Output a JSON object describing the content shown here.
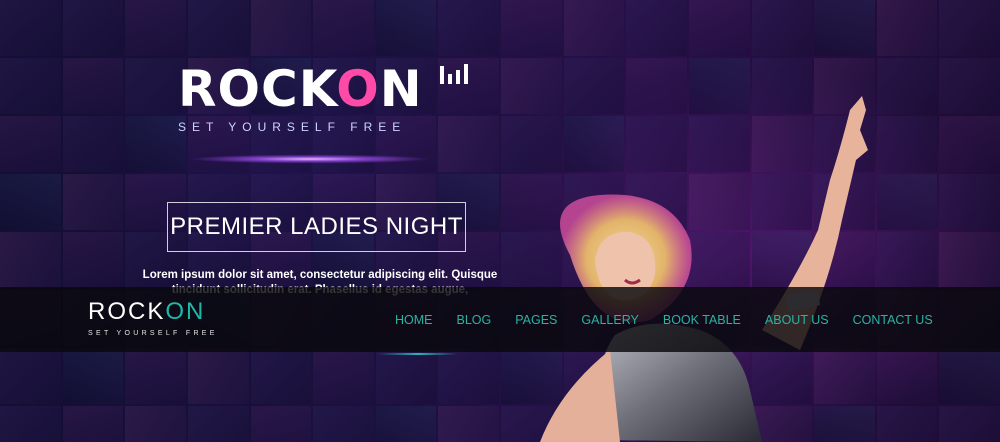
{
  "hero": {
    "logo_word_a": "ROCK",
    "logo_word_o": "O",
    "logo_word_n": "N",
    "logo_tagline": "SET YOURSELF FREE",
    "banner_title": "PREMIER LADIES NIGHT",
    "description": "Lorem ipsum dolor sit amet, consectetur adipiscing elit. Quisque tincidunt sollicitudin erat. Phasellus id egestas augue,"
  },
  "navbar": {
    "logo_word": "ROCK",
    "logo_accent": "ON",
    "logo_tagline": "SET YOURSELF FREE",
    "menu": [
      {
        "label": "HOME"
      },
      {
        "label": "BLOG"
      },
      {
        "label": "PAGES"
      },
      {
        "label": "GALLERY"
      },
      {
        "label": "BOOK TABLE"
      },
      {
        "label": "ABOUT US"
      },
      {
        "label": "CONTACT US"
      }
    ]
  },
  "colors": {
    "accent_teal": "#2ab3a3",
    "accent_pink": "#ff4aa8",
    "navbar_bg": "#08080c"
  },
  "icons": {
    "logo_mark": "equalizer-icon"
  }
}
